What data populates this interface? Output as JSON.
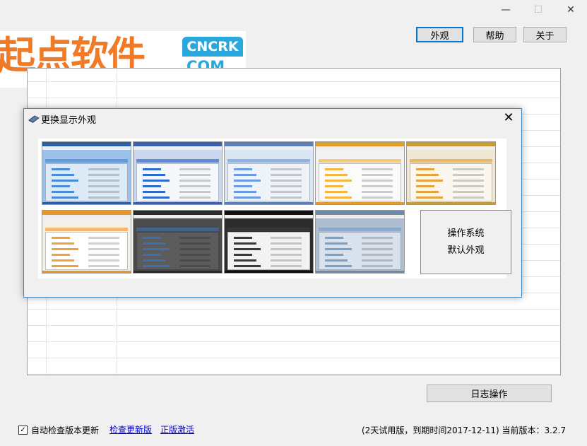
{
  "window": {
    "minimize_icon": "minimize-icon",
    "maximize_icon": "maximize-icon",
    "close_icon": "close-icon"
  },
  "logo": {
    "cn_text": "起点软件",
    "badge_text": "CNCRK",
    "com_text": ".COM"
  },
  "toolbar": {
    "appearance_label": "外观",
    "help_label": "帮助",
    "about_label": "关于"
  },
  "log_button_label": "日志操作",
  "footer": {
    "auto_check_label": "自动检查版本更新",
    "auto_check_checked": true,
    "check_update_link": "检查更新版",
    "activate_link": "正版激活",
    "status_text": "(2天试用版，到期时间2017-12-11)  当前版本：3.2.7"
  },
  "dialog": {
    "title": "更换显示外观",
    "close_label": "✕",
    "default_theme_line1": "操作系统",
    "default_theme_line2": "默认外观",
    "skins": [
      {
        "name": "skin-blue-office",
        "frame": "#9cc2ea",
        "title": "#2b5fa8",
        "panel": "#dce9f7",
        "accent": "#4b8bd6"
      },
      {
        "name": "skin-blue-classic",
        "frame": "#c9d8ee",
        "title": "#3a5fb0",
        "panel": "#f4f7fc",
        "accent": "#2d6bd0"
      },
      {
        "name": "skin-light-blue",
        "frame": "#dbe6f5",
        "title": "#5b7fb9",
        "panel": "#eef3fa",
        "accent": "#6b9be0"
      },
      {
        "name": "skin-orange-light",
        "frame": "#f2f2f2",
        "title": "#e39b2b",
        "panel": "#fbfbfb",
        "accent": "#f5b642"
      },
      {
        "name": "skin-gold",
        "frame": "#efe6d3",
        "title": "#c79b3a",
        "panel": "#fbf7ee",
        "accent": "#e7a43a"
      },
      {
        "name": "skin-orange-white",
        "frame": "#f4f1ea",
        "title": "#e8962c",
        "panel": "#ffffff",
        "accent": "#f1a33a"
      },
      {
        "name": "skin-dark-gray",
        "frame": "#4b4b4b",
        "title": "#2a2a2a",
        "panel": "#5c5c5c",
        "accent": "#3f6fa8"
      },
      {
        "name": "skin-black",
        "frame": "#2c2c2c",
        "title": "#111111",
        "panel": "#f2f2f2",
        "accent": "#3a3a3a"
      },
      {
        "name": "skin-silver-blue",
        "frame": "#aebdd0",
        "title": "#6e88a8",
        "panel": "#d8e1ec",
        "accent": "#7da0c8"
      }
    ]
  }
}
